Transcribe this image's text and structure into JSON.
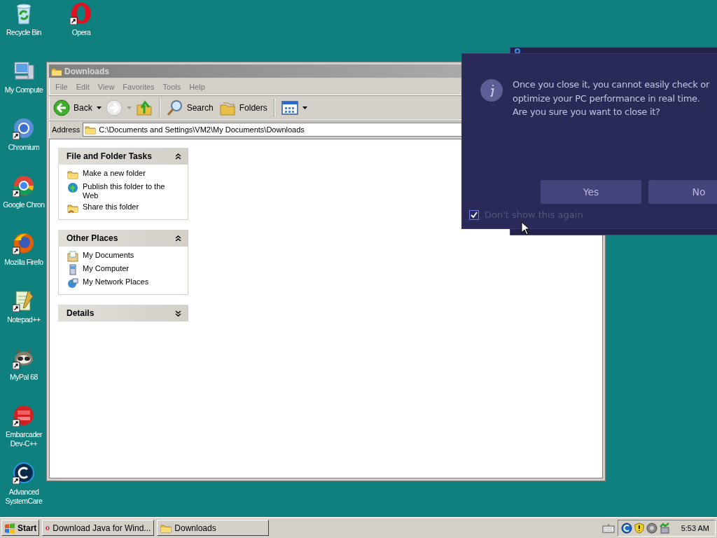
{
  "desktop_icons": [
    {
      "kind": "recycle-bin",
      "label": "Recycle Bin",
      "shortcut": false
    },
    {
      "kind": "computer",
      "label": "My Compute",
      "shortcut": false
    },
    {
      "kind": "chromium",
      "label": "Chromium",
      "shortcut": true
    },
    {
      "kind": "chrome",
      "label": "Google Chron",
      "shortcut": true
    },
    {
      "kind": "firefox",
      "label": "Mozilla Firefo",
      "shortcut": true
    },
    {
      "kind": "notepad",
      "label": "Notepad++",
      "shortcut": true
    },
    {
      "kind": "mypal",
      "label": "MyPal 68",
      "shortcut": true
    },
    {
      "kind": "devcpp",
      "label": "Embarcader\nDev-C++",
      "shortcut": true
    },
    {
      "kind": "systemcare",
      "label": "Advanced\nSystemCare",
      "shortcut": true
    },
    {
      "kind": "opera",
      "label": "Opera",
      "shortcut": true
    }
  ],
  "explorer": {
    "title": "Downloads",
    "active": false,
    "menu": [
      "File",
      "Edit",
      "View",
      "Favorites",
      "Tools",
      "Help"
    ],
    "toolbar": [
      {
        "kind": "back",
        "label": "Back",
        "disabled": false,
        "dropdown": true
      },
      {
        "kind": "forward",
        "disabled": true,
        "dropdown": true
      },
      {
        "kind": "up",
        "disabled": false,
        "dropdown": false
      },
      {
        "kind": "separator"
      },
      {
        "kind": "search",
        "label": "Search",
        "disabled": false,
        "dropdown": false
      },
      {
        "kind": "folders",
        "label": "Folders",
        "disabled": false,
        "dropdown": false
      },
      {
        "kind": "separator"
      },
      {
        "kind": "views",
        "disabled": false,
        "dropdown": true
      }
    ],
    "address": {
      "label": "Address",
      "value": "C:\\Documents and Settings\\VM2\\My Documents\\Downloads"
    },
    "task_panes": [
      {
        "title": "File and Folder Tasks",
        "expanded": true,
        "items": [
          {
            "kind": "new-folder",
            "label": "Make a new folder"
          },
          {
            "kind": "publish",
            "label": "Publish this folder to the Web"
          },
          {
            "kind": "share",
            "label": "Share this folder"
          }
        ]
      },
      {
        "title": "Other Places",
        "expanded": true,
        "items": [
          {
            "kind": "documents",
            "label": "My Documents"
          },
          {
            "kind": "computer",
            "label": "My Computer"
          },
          {
            "kind": "network",
            "label": "My Network Places"
          }
        ]
      },
      {
        "title": "Details",
        "expanded": false
      }
    ]
  },
  "dialog": {
    "message": "Once you close it, you cannot easily check or optimize your PC performance in real time. Are you sure you want to close it?",
    "buttons": [
      {
        "label": "Yes"
      },
      {
        "label": "No"
      }
    ],
    "checkbox": {
      "label": "Don't show this again",
      "checked": true
    }
  },
  "taskbar": {
    "start": "Start",
    "tasks": [
      {
        "kind": "opera",
        "label": "Download Java for Wind...",
        "selected": false
      },
      {
        "kind": "folder",
        "label": "Downloads",
        "selected": false
      }
    ],
    "clock": "5:53 AM"
  }
}
